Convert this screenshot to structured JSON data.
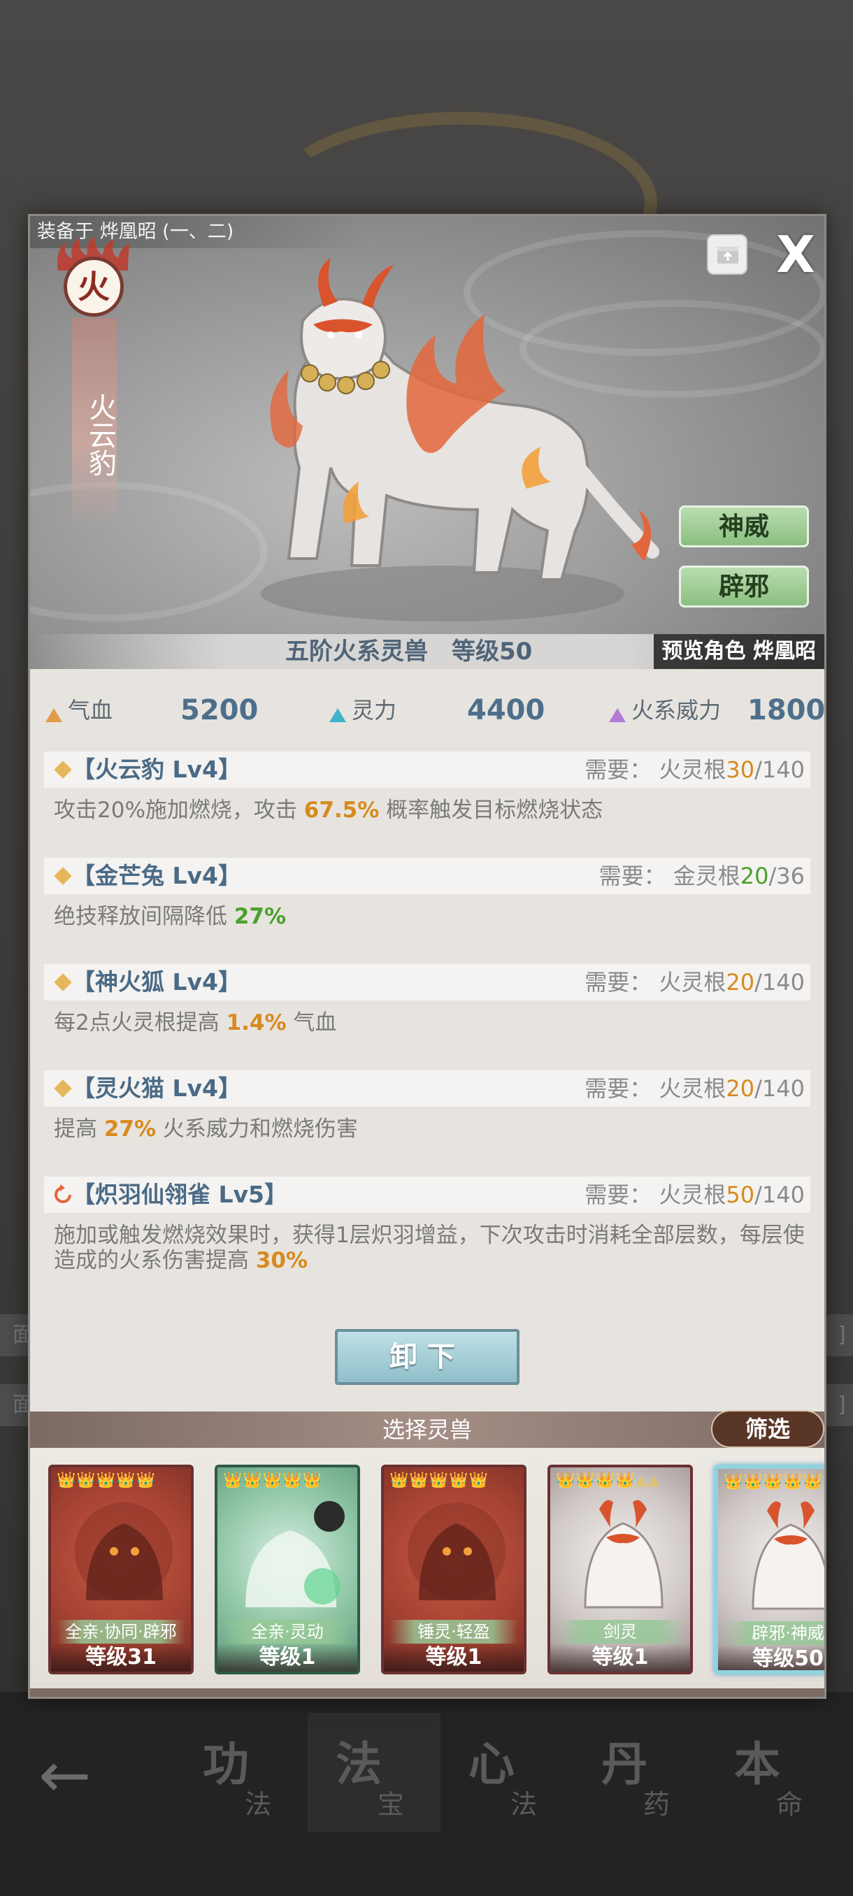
{
  "background": {
    "left_bars": [
      "面",
      "面"
    ],
    "right_bars": [
      "]",
      "]"
    ]
  },
  "nav": {
    "back": "←",
    "tabs": [
      {
        "big": "功",
        "small": "法"
      },
      {
        "big": "法",
        "small": "宝"
      },
      {
        "big": "心",
        "small": "法"
      },
      {
        "big": "丹",
        "small": "药"
      },
      {
        "big": "本",
        "small": "命"
      }
    ],
    "active_index": 1
  },
  "dialog": {
    "equipped_to": "装备于 烨凰昭 (一、二)",
    "close": "X",
    "element": "火",
    "beast_name": "火云豹",
    "side_buttons": [
      "神威",
      "辟邪"
    ],
    "rank_text": "五阶火系灵兽　等级50",
    "preview": "预览角色 烨凰昭"
  },
  "stats": [
    {
      "label": "气血",
      "value": "5200",
      "color": "#e09c4a"
    },
    {
      "label": "灵力",
      "value": "4400",
      "color": "#3fb3c7"
    },
    {
      "label": "火系威力",
      "value": "1800",
      "color": "#b37ad6"
    }
  ],
  "skills": [
    {
      "title": "【火云豹 Lv4】",
      "req_prefix": "需要：  火灵根",
      "req_cur": "30",
      "req_total": "/140",
      "req_color": "orange",
      "icon": "diamond",
      "desc_pre": "攻击20%施加燃烧，攻击 ",
      "desc_hl": "67.5%",
      "desc_post": " 概率触发目标燃烧状态",
      "hl_color": "orange"
    },
    {
      "title": "【金芒兔 Lv4】",
      "req_prefix": "需要：  金灵根",
      "req_cur": "20",
      "req_total": "/36",
      "req_color": "green",
      "icon": "diamond",
      "desc_pre": "绝技释放间隔降低 ",
      "desc_hl": "27%",
      "desc_post": "",
      "hl_color": "green"
    },
    {
      "title": "【神火狐 Lv4】",
      "req_prefix": "需要：  火灵根",
      "req_cur": "20",
      "req_total": "/140",
      "req_color": "orange",
      "icon": "diamond",
      "desc_pre": "每2点火灵根提高 ",
      "desc_hl": "1.4%",
      "desc_post": " 气血",
      "hl_color": "orange"
    },
    {
      "title": "【灵火猫 Lv4】",
      "req_prefix": "需要：  火灵根",
      "req_cur": "20",
      "req_total": "/140",
      "req_color": "orange",
      "icon": "diamond",
      "desc_pre": "提高 ",
      "desc_hl": "27%",
      "desc_post": " 火系威力和燃烧伤害",
      "hl_color": "orange"
    },
    {
      "title": "【炽羽仙翎雀 Lv5】",
      "req_prefix": "需要：  火灵根",
      "req_cur": "50",
      "req_total": "/140",
      "req_color": "orange",
      "icon": "refresh",
      "desc_pre": "施加或触发燃烧效果时，获得1层炽羽增益，下次攻击时消耗全部层数，每层使造成的火系伤害提高 ",
      "desc_hl": "30%",
      "desc_post": "",
      "hl_color": "orange"
    }
  ],
  "unequip": "卸下",
  "select_title": "选择灵兽",
  "filter": "筛选",
  "cards": [
    {
      "style": "red",
      "stars": "👑👑👑👑👑",
      "dim": "",
      "tags": "全亲·协同·辟邪",
      "level": "等级31",
      "selected": false
    },
    {
      "style": "green",
      "stars": "👑👑👑👑👑",
      "dim": "",
      "tags": "全亲·灵动",
      "level": "等级1",
      "selected": false
    },
    {
      "style": "red",
      "stars": "👑👑👑👑👑",
      "dim": "",
      "tags": "锤灵·轻盈",
      "level": "等级1",
      "selected": false
    },
    {
      "style": "white",
      "stars": "👑👑👑👑",
      "dim": "▲▲",
      "tags": "剑灵",
      "level": "等级1",
      "selected": false
    },
    {
      "style": "white",
      "stars": "👑👑👑👑👑",
      "dim": "",
      "tags": "辟邪·神威",
      "level": "等级50",
      "selected": true
    }
  ]
}
